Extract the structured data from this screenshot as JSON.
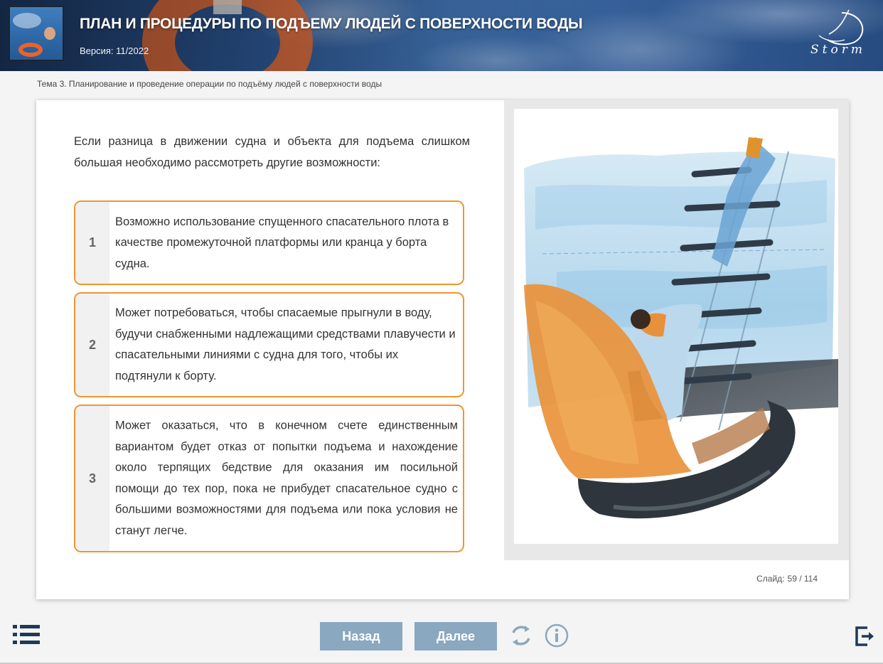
{
  "header": {
    "title": "ПЛАН И ПРОЦЕДУРЫ ПО ПОДЪЕМУ ЛЮДЕЙ С ПОВЕРХНОСТИ ВОДЫ",
    "version": "Версия: 11/2022",
    "logo_text": "Storm"
  },
  "breadcrumb": "Тема 3. Планирование и проведение операции по подъёму людей с поверхности воды",
  "slide": {
    "intro": "Если разница в движении судна и объекта для подъема слишком большая необходимо рассмотреть другие возможности:",
    "items": [
      {
        "number": "1",
        "text": "Возможно использование спущенного спасательного плота в качестве промежуточной платформы или кранца у борта судна."
      },
      {
        "number": "2",
        "text": "Может потребоваться, чтобы спасаемые прыгнули в воду, будучи снабженными надлежащими средствами плавучести и спасательными линиями с судна для того, чтобы их подтянули к борту."
      },
      {
        "number": "3",
        "text": "Может оказаться, что в конечном счете единственным вариантом будет отказ от попытки подъема и нахождение около терпящих бедствие для оказания им посильной помощи до тех пор, пока не прибудет спасательное судно с большими возможностями для подъема или пока условия не станут легче."
      }
    ],
    "counter_label": "Слайд:",
    "counter_value": "59 / 114"
  },
  "nav": {
    "back_label": "Назад",
    "next_label": "Далее"
  },
  "colors": {
    "accent_border": "#f0962f",
    "nav_button": "#8aa8bf",
    "icon_color": "#8aa8bf",
    "dark_icon": "#1f3a57"
  },
  "icons": {
    "menu": "list-menu-icon",
    "reload": "reload-icon",
    "info": "info-icon",
    "exit": "exit-icon"
  }
}
